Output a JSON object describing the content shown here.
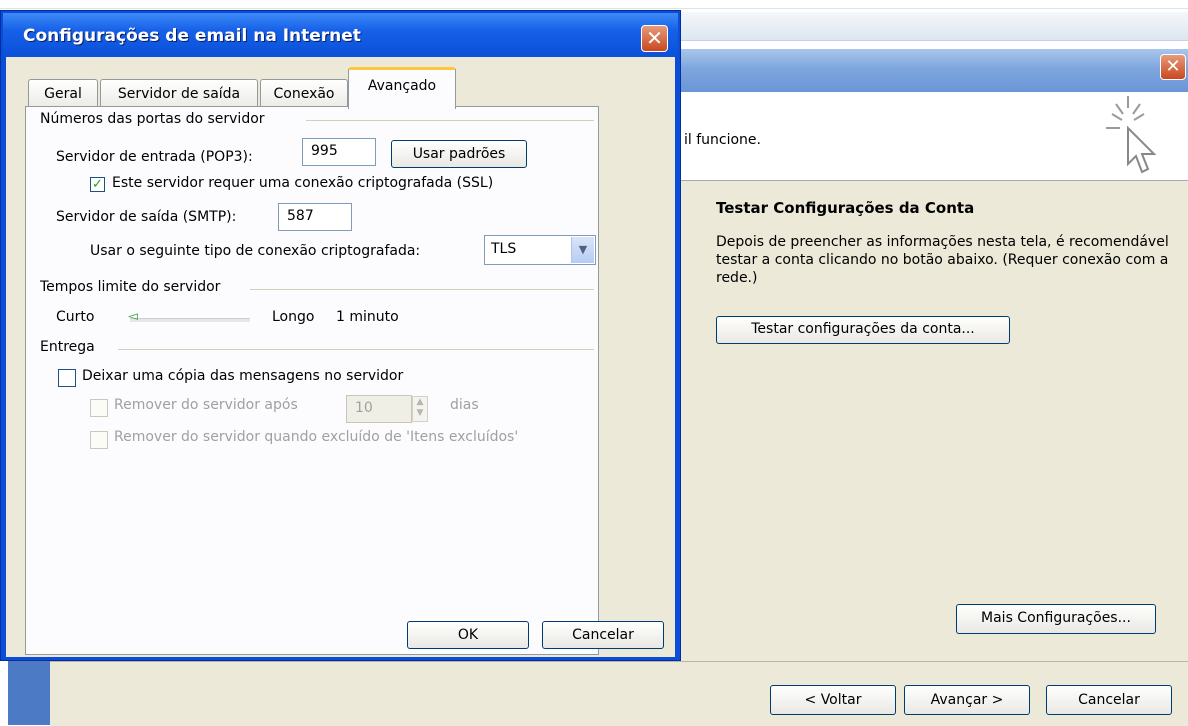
{
  "background_window": {
    "partial_text": "il funcione.",
    "close_label": "✕",
    "minimize_label": "–",
    "test_section": {
      "title": "Testar Configurações da Conta",
      "description": "Depois de preencher as informações nesta tela, é recomendável testar a conta clicando no botão abaixo. (Requer conexão com a rede.)",
      "test_button": "Testar configurações da conta..."
    },
    "more_settings_button": "Mais Configurações...",
    "footer": {
      "back_button": "< Voltar",
      "next_button": "Avançar >",
      "cancel_button": "Cancelar"
    }
  },
  "dialog": {
    "title": "Configurações de email na Internet",
    "close_label": "✕",
    "tabs": [
      {
        "label": "Geral",
        "active": false
      },
      {
        "label": "Servidor de saída",
        "active": false
      },
      {
        "label": "Conexão",
        "active": false
      },
      {
        "label": "Avançado",
        "active": true
      }
    ],
    "server_ports": {
      "group_label": "Números das portas do servidor",
      "incoming_label": "Servidor de entrada (POP3):",
      "incoming_value": "995",
      "use_defaults_button": "Usar padrões",
      "ssl_checkbox_label": "Este servidor requer uma conexão criptografada (SSL)",
      "ssl_checked": true,
      "outgoing_label": "Servidor de saída (SMTP):",
      "outgoing_value": "587",
      "encryption_label": "Usar o seguinte tipo de conexão criptografada:",
      "encryption_value": "TLS"
    },
    "timeouts": {
      "group_label": "Tempos limite do servidor",
      "short_label": "Curto",
      "long_label": "Longo",
      "value_label": "1 minuto"
    },
    "delivery": {
      "group_label": "Entrega",
      "leave_copy_label": "Deixar uma cópia das mensagens no servidor",
      "leave_copy_checked": false,
      "remove_after_label": "Remover do servidor após",
      "remove_after_value": "10",
      "days_label": "dias",
      "remove_when_deleted_label": "Remover do servidor quando excluído de 'Itens excluídos'"
    },
    "ok_button": "OK",
    "cancel_button": "Cancelar"
  }
}
